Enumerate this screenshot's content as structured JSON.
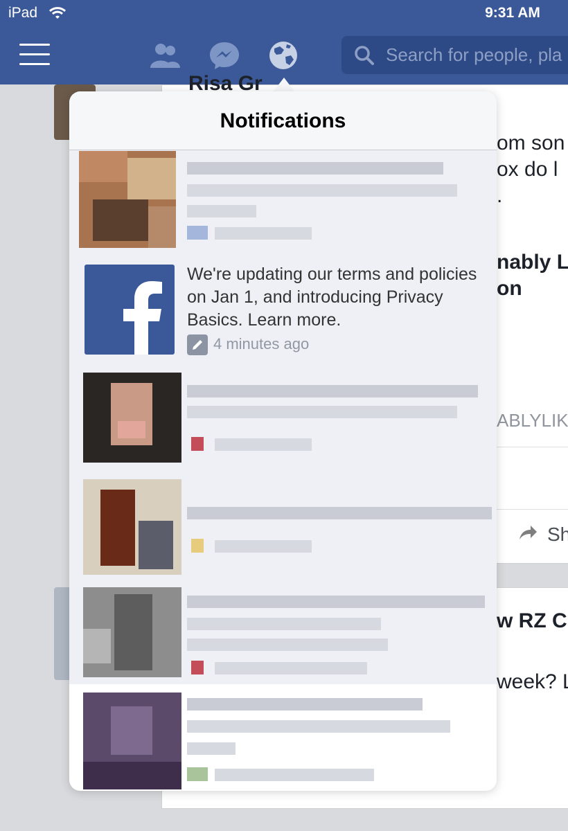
{
  "status_bar": {
    "carrier": "iPad",
    "time": "9:31 AM"
  },
  "nav": {
    "search_placeholder": "Search for people, pla",
    "icons": [
      "menu-icon",
      "friends-icon",
      "messenger-icon",
      "globe-icon",
      "search-icon"
    ]
  },
  "background": {
    "snippets": [
      "Risa Gr",
      "om son",
      "ox do l",
      ".",
      "nably Li",
      "on",
      "ABLYLIK",
      "Sh",
      "w RZ C",
      "week? L"
    ]
  },
  "notifications": {
    "title": "Notifications",
    "items": [
      {
        "text": "",
        "time": "",
        "blurred": true
      },
      {
        "text": "We're updating our terms and policies on Jan 1, and introducing Privacy Basics. Learn more.",
        "time": "4 minutes ago",
        "icon": "facebook-logo"
      },
      {
        "text": "",
        "time": "",
        "blurred": true
      },
      {
        "text": "",
        "time": "",
        "blurred": true
      },
      {
        "text": "",
        "time": "",
        "blurred": true
      },
      {
        "text": "",
        "time": "",
        "blurred": true
      }
    ]
  },
  "colors": {
    "brand": "#3b5998",
    "popover_bg": "#eef0f6",
    "meta_text": "#9197a3"
  }
}
